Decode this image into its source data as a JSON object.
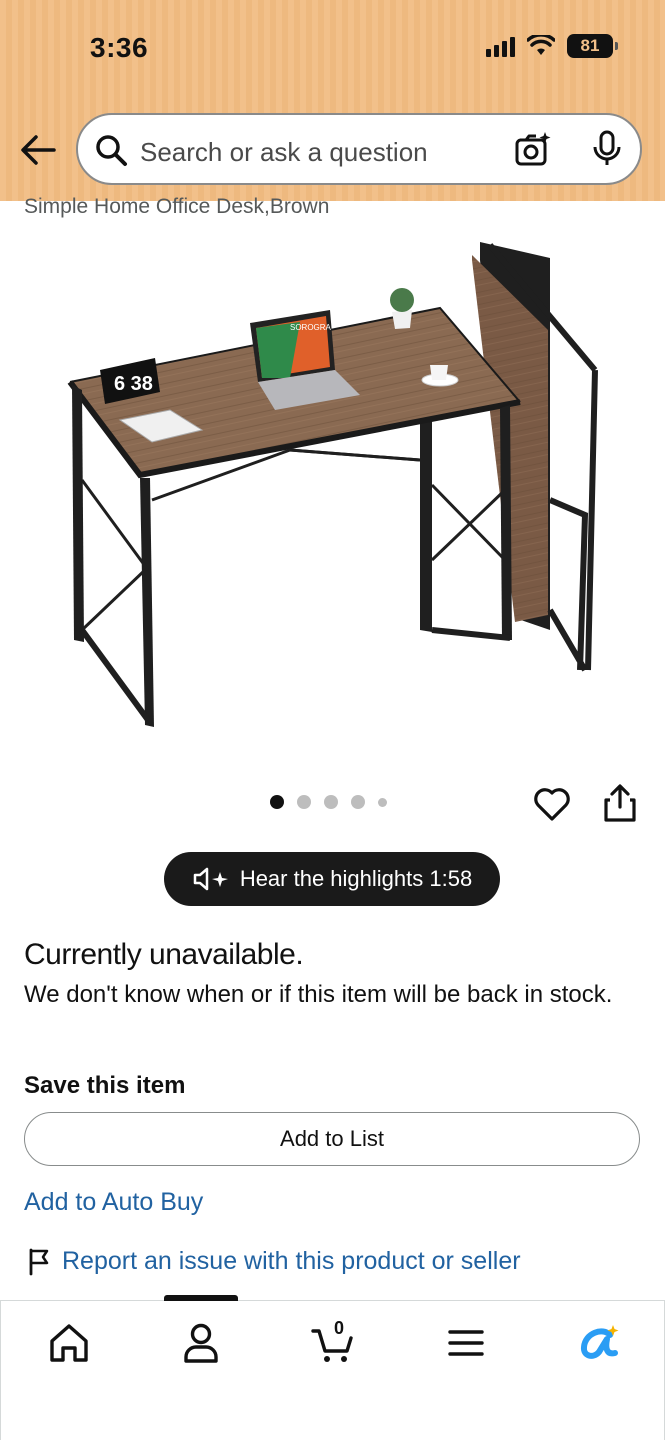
{
  "status_bar": {
    "time": "3:36",
    "battery": "81"
  },
  "search": {
    "placeholder": "Search or ask a question"
  },
  "product": {
    "subtitle": "Simple Home Office Desk,Brown",
    "image_text": "6 38",
    "laptop_brand": "SOROGRA"
  },
  "carousel": {
    "total_dots": 5,
    "active_index": 0
  },
  "audio": {
    "label": "Hear the highlights 1:58"
  },
  "availability": {
    "title": "Currently unavailable.",
    "message": "We don't know when or if this item will be back in stock."
  },
  "save": {
    "title": "Save this item",
    "add_to_list_label": "Add to List"
  },
  "auto_buy_label": "Add to Auto Buy",
  "report_label": "Report an issue with this product or seller",
  "tabbar": {
    "items": [
      "home-icon",
      "account-icon",
      "cart-icon",
      "menu-icon",
      "rufus-icon"
    ],
    "cart_count": "0",
    "active_index": 1
  },
  "colors": {
    "header_bg": "#f2c08a",
    "link": "#2162a1",
    "rufus_accent": "#2a9df4"
  }
}
